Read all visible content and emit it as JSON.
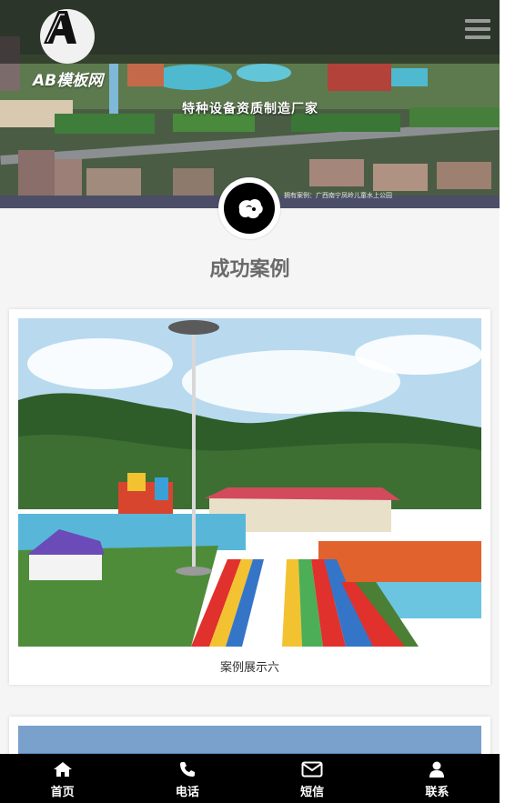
{
  "header": {
    "logo_letter": "A",
    "logo_text": "AB模板网",
    "menu_icon": "hamburger-menu-icon"
  },
  "hero": {
    "slogan": "特种设备资质制造厂家",
    "caption": "拥有案例：广西南宁凤岭儿童水上公园"
  },
  "section": {
    "icon": "cloud-bird-icon",
    "title": "成功案例"
  },
  "cases": [
    {
      "caption": "案例展示六"
    }
  ],
  "bottom_nav": [
    {
      "label": "首页",
      "icon": "home-icon"
    },
    {
      "label": "电话",
      "icon": "phone-icon"
    },
    {
      "label": "短信",
      "icon": "mail-icon"
    },
    {
      "label": "联系",
      "icon": "user-icon"
    }
  ],
  "colors": {
    "nav_background": "#000000",
    "page_background": "#f5f5f5",
    "title_color": "#6a6a6a"
  }
}
